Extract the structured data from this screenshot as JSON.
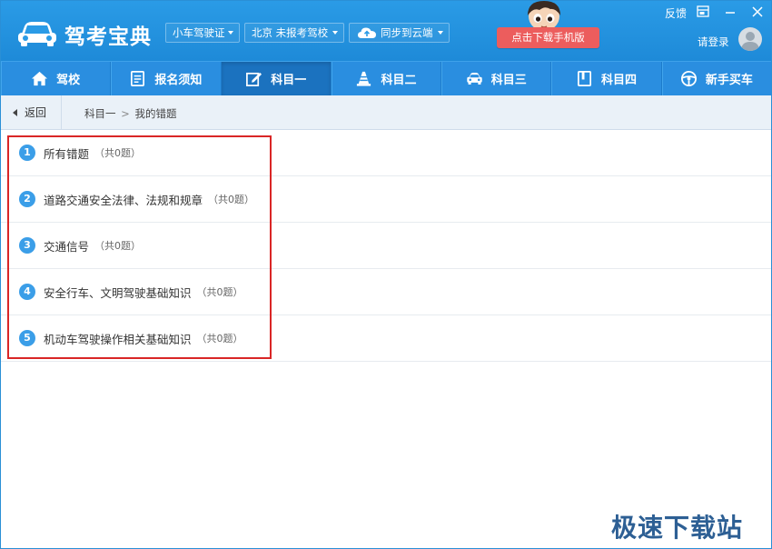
{
  "app": {
    "title": "驾考宝典",
    "license_type": "小车驾驶证",
    "city_school": "北京 未报考驾校",
    "sync_label": "同步到云端",
    "download_button": "点击下载手机版",
    "feedback": "反馈",
    "login": "请登录"
  },
  "nav": {
    "items": [
      {
        "label": "驾校",
        "icon": "home-icon"
      },
      {
        "label": "报名须知",
        "icon": "document-icon"
      },
      {
        "label": "科目一",
        "icon": "edit-icon",
        "active": true
      },
      {
        "label": "科目二",
        "icon": "traffic-cone-icon"
      },
      {
        "label": "科目三",
        "icon": "car-icon"
      },
      {
        "label": "科目四",
        "icon": "book-icon"
      },
      {
        "label": "新手买车",
        "icon": "steering-wheel-icon"
      }
    ]
  },
  "breadcrumb": {
    "back": "返回",
    "parent": "科目一",
    "separator": ">",
    "current": "我的错题"
  },
  "categories": [
    {
      "index": "1",
      "title": "所有错题",
      "count": "（共0题）"
    },
    {
      "index": "2",
      "title": "道路交通安全法律、法规和规章",
      "count": "（共0题）"
    },
    {
      "index": "3",
      "title": "交通信号",
      "count": "（共0题）"
    },
    {
      "index": "4",
      "title": "安全行车、文明驾驶基础知识",
      "count": "（共0题）"
    },
    {
      "index": "5",
      "title": "机动车驾驶操作相关基础知识",
      "count": "（共0题）"
    }
  ],
  "watermark": "极速下载站",
  "colors": {
    "titlebar": "#2a9be6",
    "nav": "#2a8ee0",
    "nav_active": "#1b72bf",
    "download_button": "#ec5d5d",
    "number_badge": "#3b9ee8",
    "highlight": "#d92626"
  }
}
